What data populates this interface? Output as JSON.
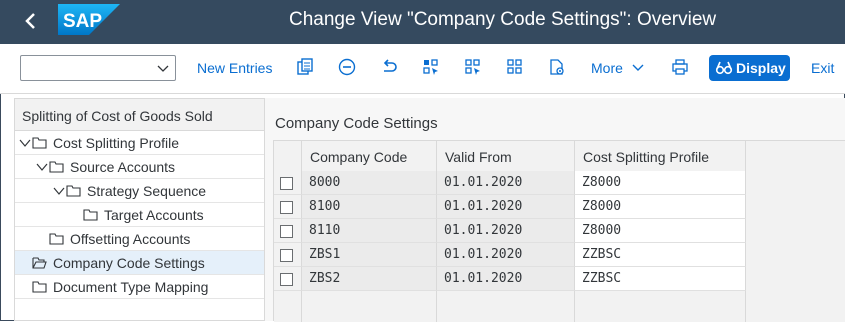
{
  "window": {
    "title": "Change View \"Company Code Settings\": Overview",
    "logo": "SAP"
  },
  "toolbar": {
    "new_entries": "New Entries",
    "more": "More",
    "display": "Display",
    "exit": "Exit",
    "icons": [
      "copy-icon",
      "delete-icon",
      "undo-icon",
      "select-all-icon",
      "select-block-icon",
      "deselect-all-icon",
      "transport-icon",
      "print-icon"
    ]
  },
  "tree": {
    "header": "Splitting of Cost of Goods Sold",
    "items": [
      {
        "label": "Cost Splitting Profile"
      },
      {
        "label": "Source Accounts"
      },
      {
        "label": "Strategy Sequence"
      },
      {
        "label": "Target Accounts"
      },
      {
        "label": "Offsetting Accounts"
      },
      {
        "label": "Company Code Settings"
      },
      {
        "label": "Document Type Mapping"
      }
    ]
  },
  "main": {
    "section_title": "Company Code Settings",
    "columns": [
      "Company Code",
      "Valid From",
      "Cost Splitting Profile"
    ],
    "rows": [
      {
        "company_code": "8000",
        "valid_from": "01.01.2020",
        "profile": "Z8000"
      },
      {
        "company_code": "8100",
        "valid_from": "01.01.2020",
        "profile": "Z8000"
      },
      {
        "company_code": "8110",
        "valid_from": "01.01.2020",
        "profile": "Z8000"
      },
      {
        "company_code": "ZBS1",
        "valid_from": "01.01.2020",
        "profile": "ZZBSC"
      },
      {
        "company_code": "ZBS2",
        "valid_from": "01.01.2020",
        "profile": "ZZBSC"
      }
    ]
  }
}
